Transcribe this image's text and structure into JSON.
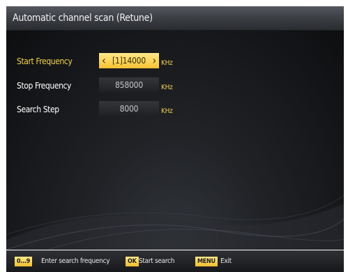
{
  "title": "Automatic channel scan (Retune)",
  "fields": [
    {
      "label": "Start Frequency",
      "value": "[1]14000",
      "unit": "KHz",
      "selected": true
    },
    {
      "label": "Stop Frequency",
      "value": "858000",
      "unit": "KHz",
      "selected": false
    },
    {
      "label": "Search Step",
      "value": "8000",
      "unit": "KHz",
      "selected": false
    }
  ],
  "arrows": {
    "left": "‹",
    "right": "›"
  },
  "footer": {
    "digits_key": "0...9",
    "digits_text": "Enter search frequency",
    "ok_key": "OK",
    "ok_text": "Start search",
    "menu_key": "MENU",
    "menu_text": "Exit"
  },
  "colors": {
    "accent": "#f3d24a",
    "highlight": "#f6c233",
    "background": "#141518"
  }
}
